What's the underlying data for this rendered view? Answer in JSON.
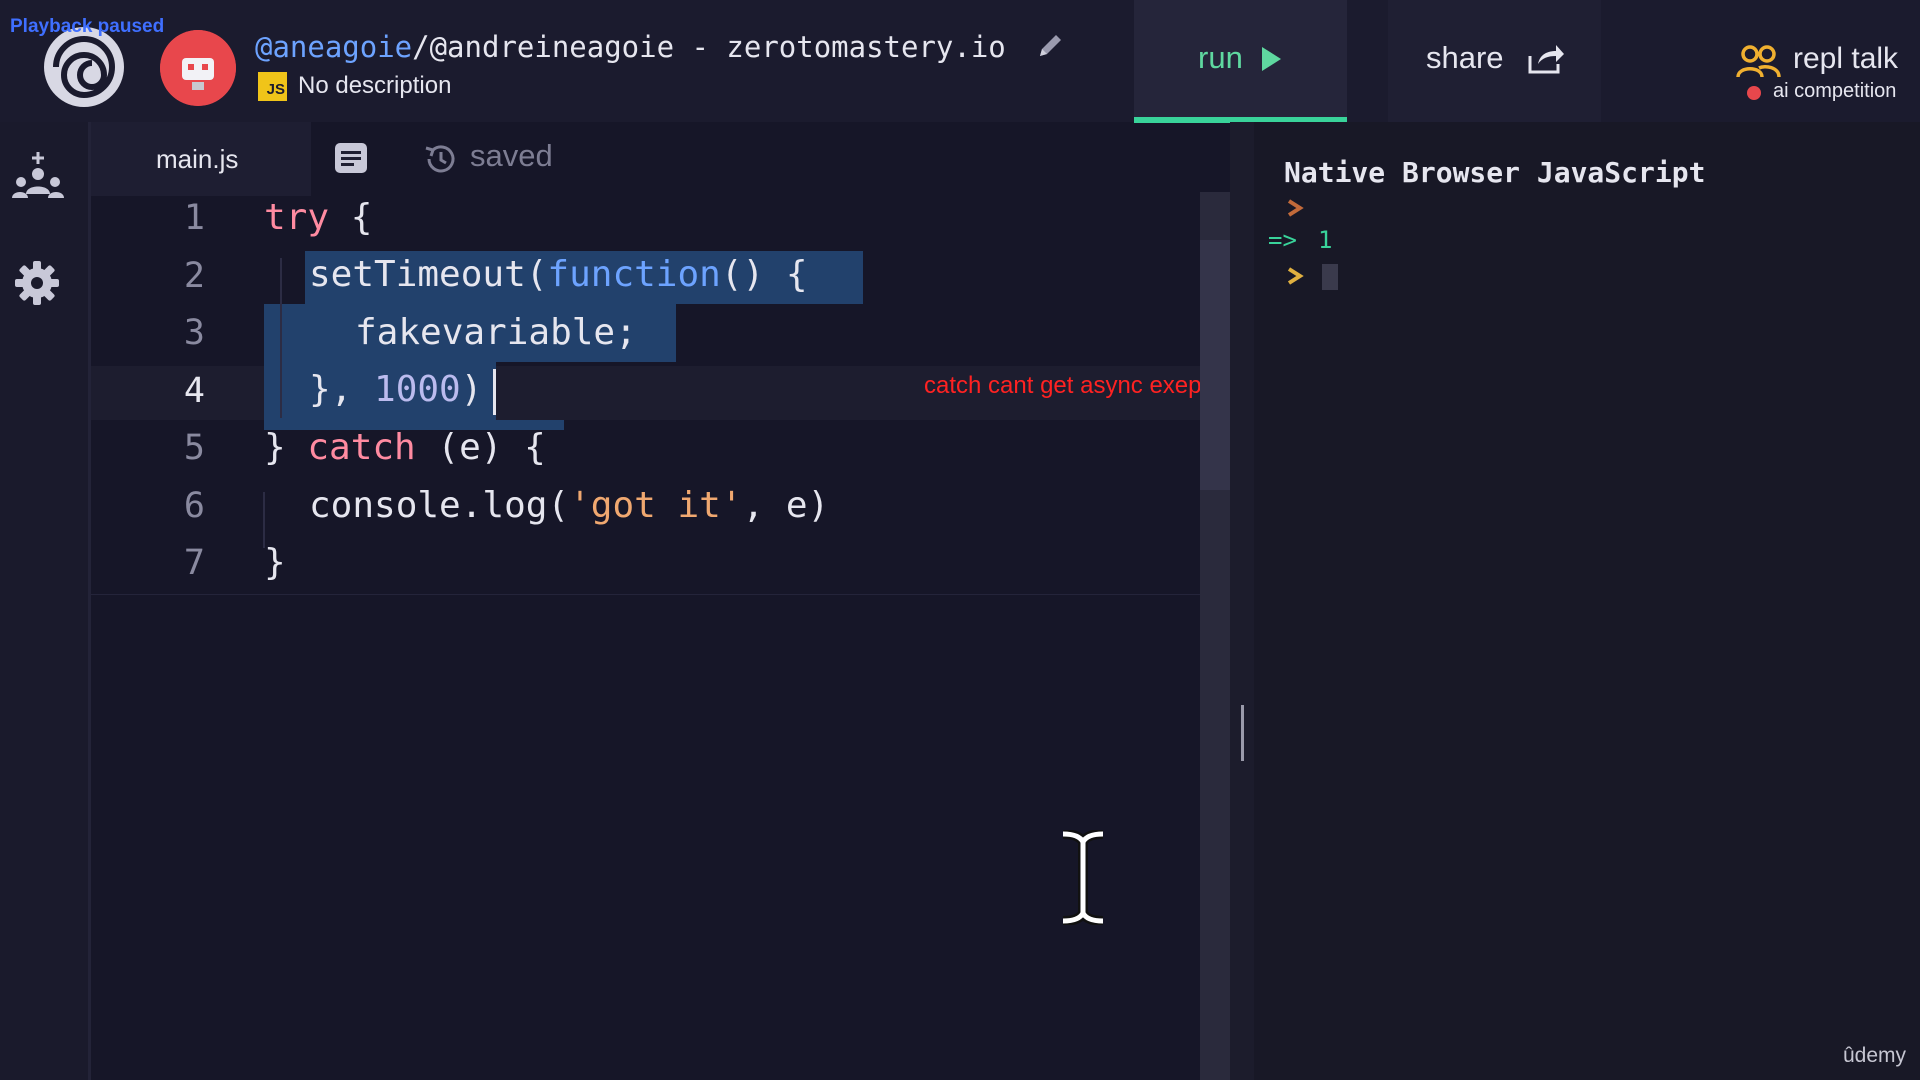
{
  "overlay": {
    "playback_status": "Playback paused"
  },
  "header": {
    "logo_icon": "spiral-logo-icon",
    "avatar_icon": "robot-avatar-icon",
    "repl_owner": "@aneagoie",
    "repl_name": "/@andreineagoie - zerotomastery.io",
    "edit_icon": "pencil-icon",
    "language_badge": "JS",
    "description": "No description",
    "run_label": "run",
    "share_label": "share",
    "talk_label": "repl talk",
    "talk_sub": "ai competition"
  },
  "sidebar": {
    "items": [
      "add-user-icon",
      "settings-icon"
    ]
  },
  "tabs": {
    "file": "main.js",
    "status": "saved"
  },
  "editor": {
    "line_numbers": [
      "1",
      "2",
      "3",
      "4",
      "5",
      "6",
      "7"
    ],
    "active_line": 4,
    "lines": [
      [
        "try",
        " {"
      ],
      [
        "setTimeout(",
        "function",
        "() {"
      ],
      [
        "fakevariable;"
      ],
      [
        "}, ",
        "1000",
        ")"
      ],
      [
        "} ",
        "catch",
        " (e) {"
      ],
      [
        "console.log(",
        "'got it'",
        ", e)"
      ],
      [
        "}"
      ]
    ],
    "annotation": "catch cant get async exeptions"
  },
  "console": {
    "title": "Native Browser JavaScript",
    "result_arrow": "=>",
    "result_value": "1"
  },
  "watermark": "ûdemy",
  "colors": {
    "accent_run": "#39d39a",
    "keyword": "#ff8ba1",
    "function": "#6da3ff",
    "string": "#f0a870",
    "selection": "#22416c",
    "annotation": "#ff2222"
  }
}
